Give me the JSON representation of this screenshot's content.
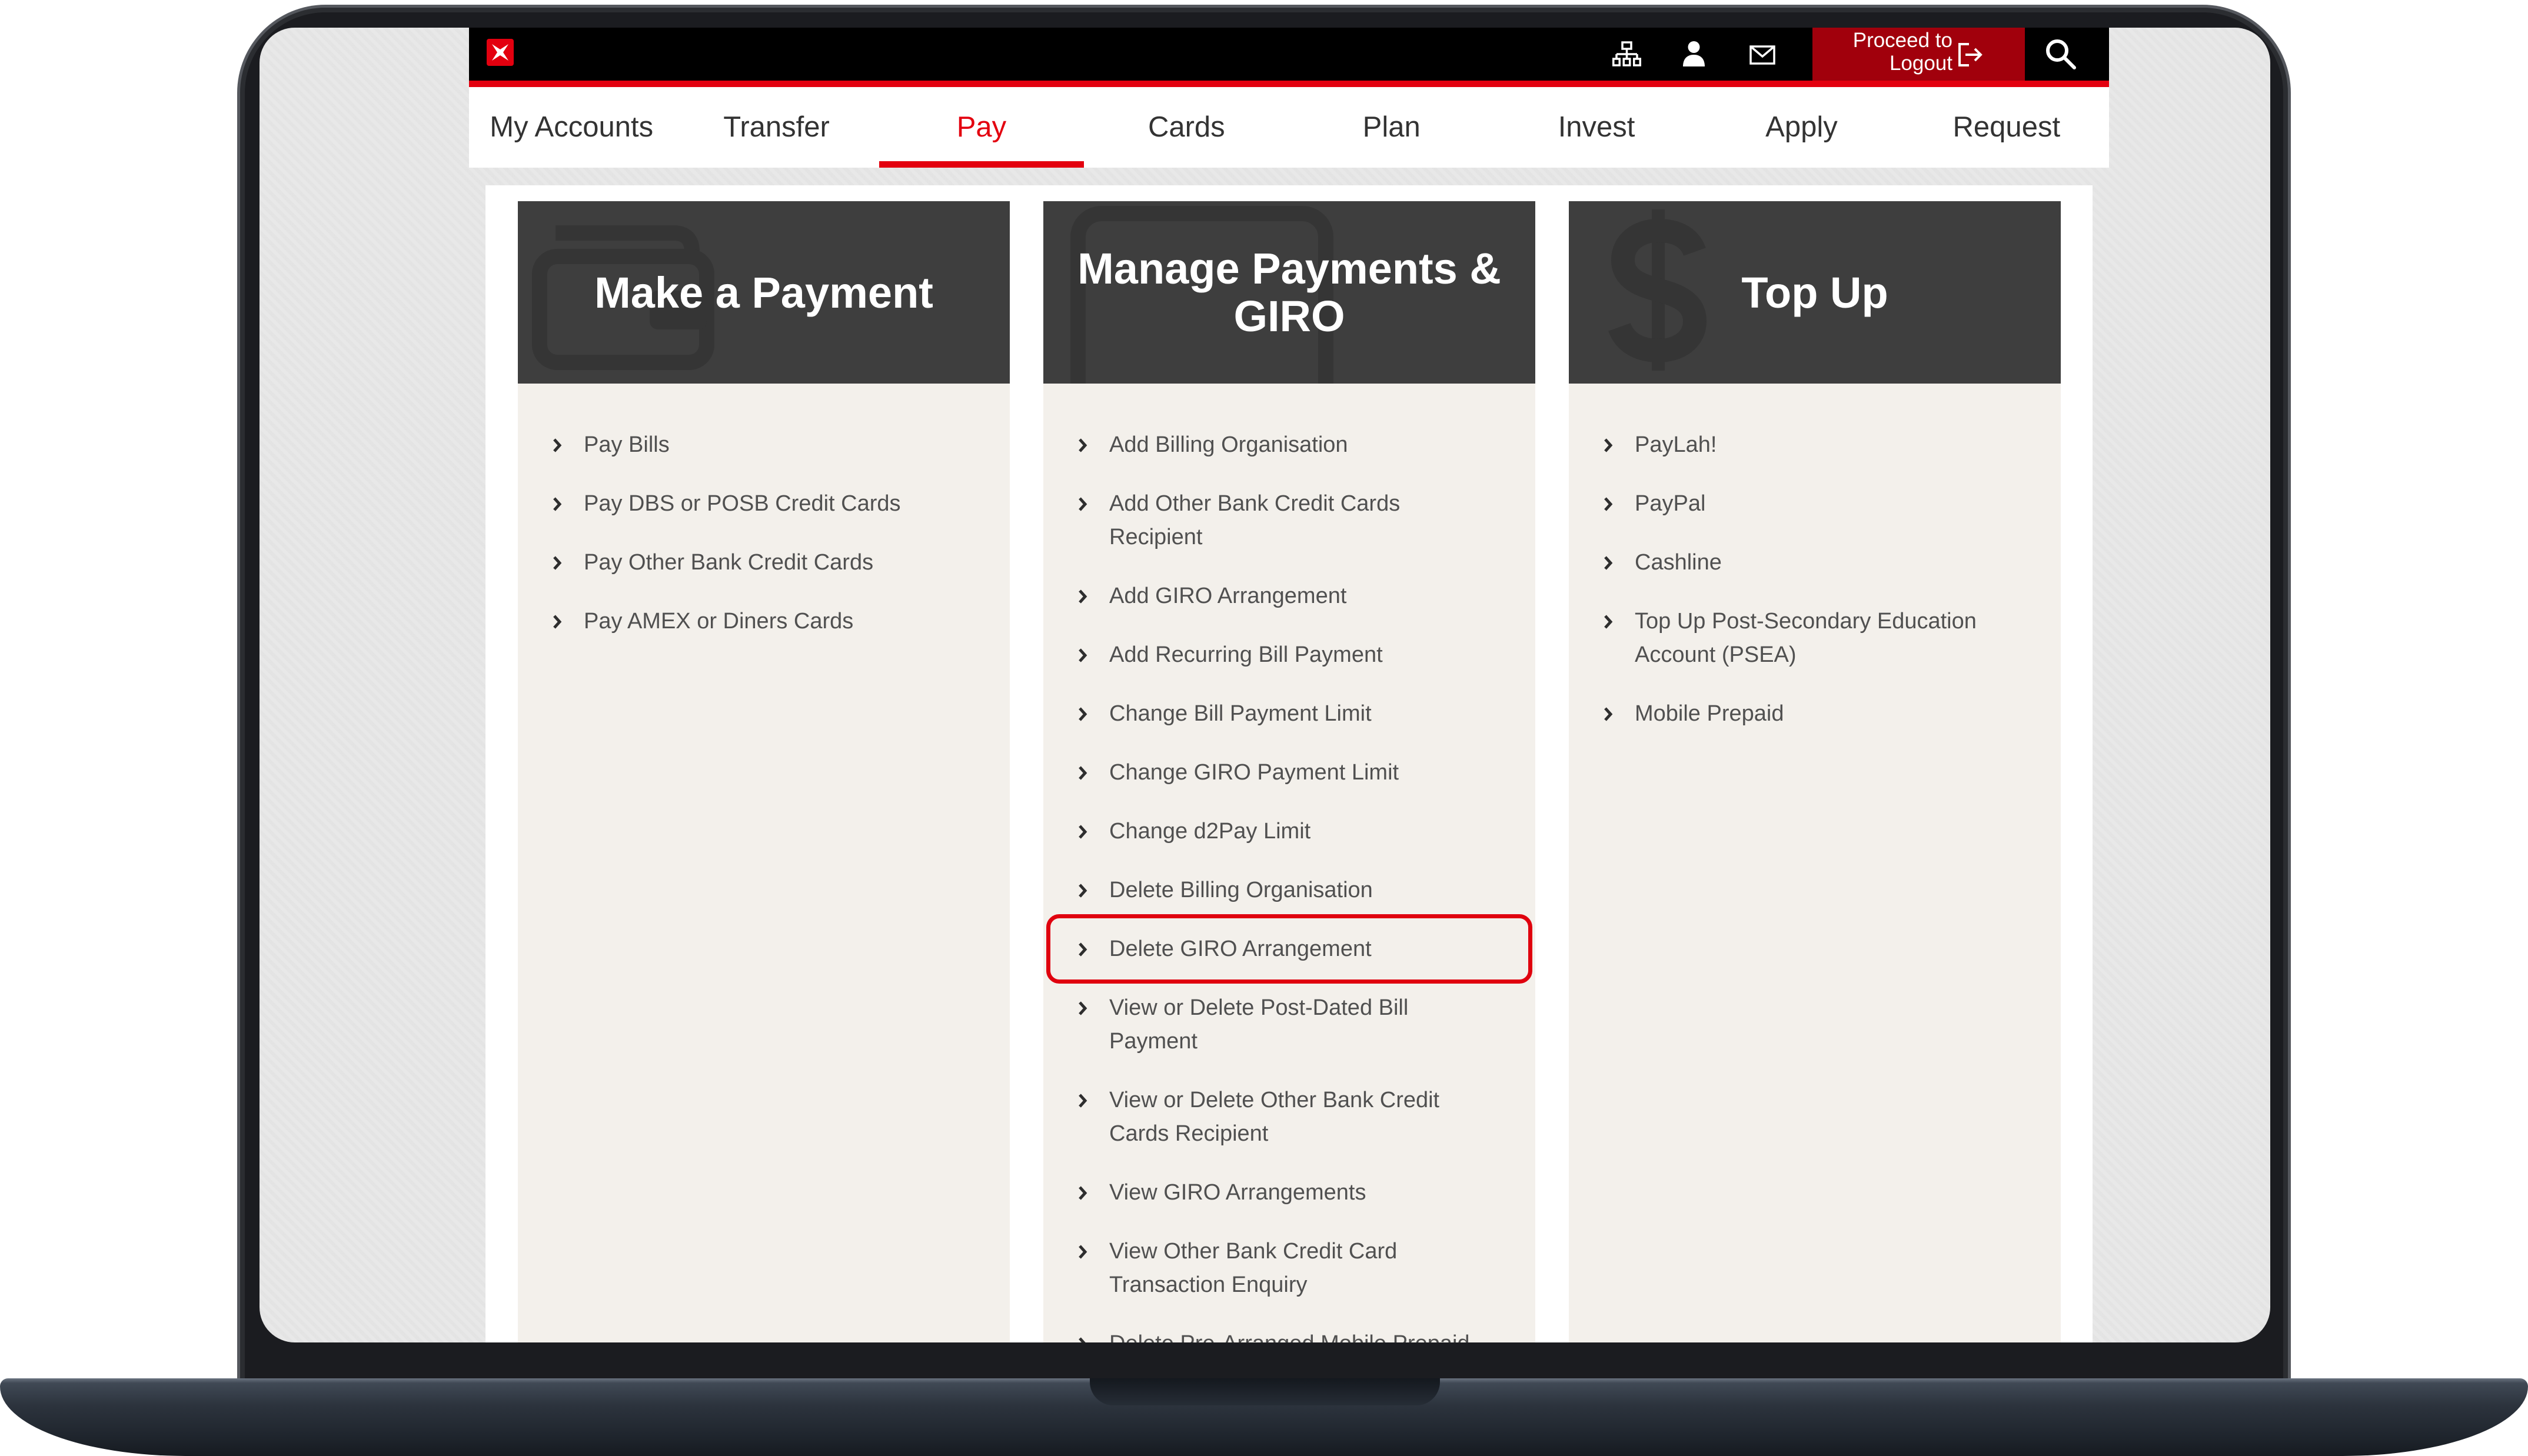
{
  "header": {
    "logo_icon": "dbs-logo-icon",
    "icons": [
      "sitemap-icon",
      "user-icon",
      "mail-icon",
      "search-icon"
    ],
    "logout": {
      "line1": "Proceed to",
      "line2": "Logout",
      "icon": "logout-icon"
    }
  },
  "nav": {
    "items": [
      {
        "label": "My Accounts"
      },
      {
        "label": "Transfer"
      },
      {
        "label": "Pay",
        "active": true
      },
      {
        "label": "Cards"
      },
      {
        "label": "Plan"
      },
      {
        "label": "Invest"
      },
      {
        "label": "Apply"
      },
      {
        "label": "Request"
      }
    ]
  },
  "columns": [
    {
      "title": "Make a Payment",
      "icon": "wallet-icon",
      "items": [
        {
          "label": "Pay Bills"
        },
        {
          "label": "Pay DBS or POSB Credit Cards"
        },
        {
          "label": "Pay Other Bank Credit Cards"
        },
        {
          "label": "Pay AMEX or Diners Cards"
        }
      ]
    },
    {
      "title": "Manage Payments & GIRO",
      "icon": "card-icon",
      "items": [
        {
          "label": "Add Billing Organisation"
        },
        {
          "label": "Add Other Bank Credit Cards Recipient"
        },
        {
          "label": "Add GIRO Arrangement"
        },
        {
          "label": "Add Recurring Bill Payment"
        },
        {
          "label": "Change Bill Payment Limit"
        },
        {
          "label": "Change GIRO Payment Limit"
        },
        {
          "label": "Change d2Pay Limit"
        },
        {
          "label": "Delete Billing Organisation"
        },
        {
          "label": "Delete GIRO Arrangement",
          "highlighted": true
        },
        {
          "label": "View or Delete Post-Dated Bill Payment"
        },
        {
          "label": "View or Delete Other Bank Credit Cards Recipient"
        },
        {
          "label": "View GIRO Arrangements"
        },
        {
          "label": "View Other Bank Credit Card Transaction Enquiry"
        },
        {
          "label": "Delete Pre-Arranged Mobile Prepaid"
        }
      ]
    },
    {
      "title": "Top Up",
      "icon": "dollar-icon",
      "items": [
        {
          "label": "PayLah!"
        },
        {
          "label": "PayPal"
        },
        {
          "label": "Cashline"
        },
        {
          "label": "Top Up Post-Secondary Education Account (PSEA)"
        },
        {
          "label": "Mobile Prepaid"
        }
      ]
    }
  ],
  "colors": {
    "accent": "#e3000f",
    "logout_bg": "#a1000c",
    "topbar_bg": "#000000",
    "column_header_bg": "#3e3e3e",
    "column_body_bg": "#f3f0eb",
    "highlight": "#e0000e",
    "text": "#505050"
  }
}
